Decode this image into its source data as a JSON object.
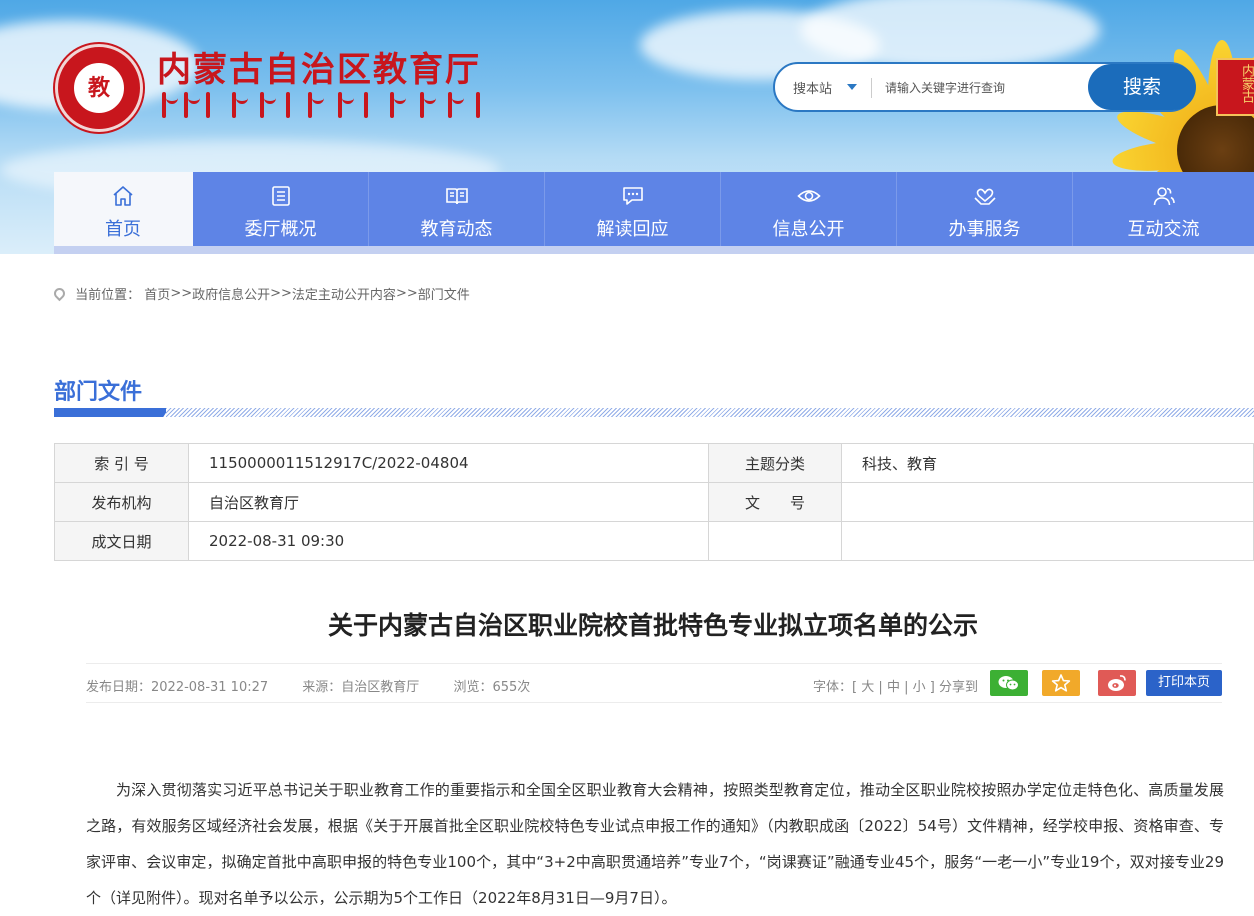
{
  "header": {
    "site_title": "内蒙古自治区教育厅",
    "logo_glyph": "教",
    "tag_text": "内蒙古",
    "search": {
      "scope_label": "搜本站",
      "placeholder": "请输入关键字进行查询",
      "button_label": "搜索"
    }
  },
  "nav": {
    "items": [
      {
        "label": "首页",
        "icon": "home-icon"
      },
      {
        "label": "委厅概况",
        "icon": "list-icon"
      },
      {
        "label": "教育动态",
        "icon": "book-icon"
      },
      {
        "label": "解读回应",
        "icon": "chat-icon"
      },
      {
        "label": "信息公开",
        "icon": "eye-icon"
      },
      {
        "label": "办事服务",
        "icon": "handshake-icon"
      },
      {
        "label": "互动交流",
        "icon": "people-icon"
      }
    ],
    "active_index": 0
  },
  "breadcrumb": {
    "prefix": "当前位置：",
    "items": [
      "首页",
      "政府信息公开",
      "法定主动公开内容",
      "部门文件"
    ],
    "separator": ">>"
  },
  "section": {
    "title": "部门文件"
  },
  "meta_table": {
    "index_label": "索 引 号",
    "index_value": "11500000115129­17C/2022-04804",
    "topic_label": "主题分类",
    "topic_value": "科技、教育",
    "issuer_label": "发布机构",
    "issuer_value": "自治区教育厅",
    "docno_label": "文　　号",
    "docno_value": "",
    "date_label": "成文日期",
    "date_value": "2022-08-31 09:30"
  },
  "article": {
    "title": "关于内蒙古自治区职业院校首批特色专业拟立项名单的公示",
    "publish_date": "发布日期：2022-08-31 10:27",
    "source": "来源：自治区教育厅",
    "views": "浏览：655次",
    "font_label": "字体：[",
    "font_large": "大",
    "font_medium": "中",
    "font_small": "小",
    "font_close": "]",
    "share_label": "分享到",
    "print_label": "打印本页",
    "body": "为深入贯彻落实习近平总书记关于职业教育工作的重要指示和全国全区职业教育大会精神，按照类型教育定位，推动全区职业院校按照办学定位走特色化、高质量发展之路，有效服务区域经济社会发展，根据《关于开展首批全区职业院校特色专业试点申报工作的通知》（内教职成函〔2022〕54号）文件精神，经学校申报、资格审查、专家评审、会议审定，拟确定首批中高职申报的特色专业100个，其中“3+2中高职贯通培养”专业7个，“岗课赛证”融通专业45个，服务“一老一小”专业19个，双对接专业29个（详见附件）。现对名单予以公示，公示期为5个工作日（2022年8月31日—9月7日）。"
  },
  "colors": {
    "nav_bg": "#5e84e6",
    "accent": "#3a6fd8",
    "brand_red": "#c8161d",
    "search_button": "#1b6cbb"
  }
}
